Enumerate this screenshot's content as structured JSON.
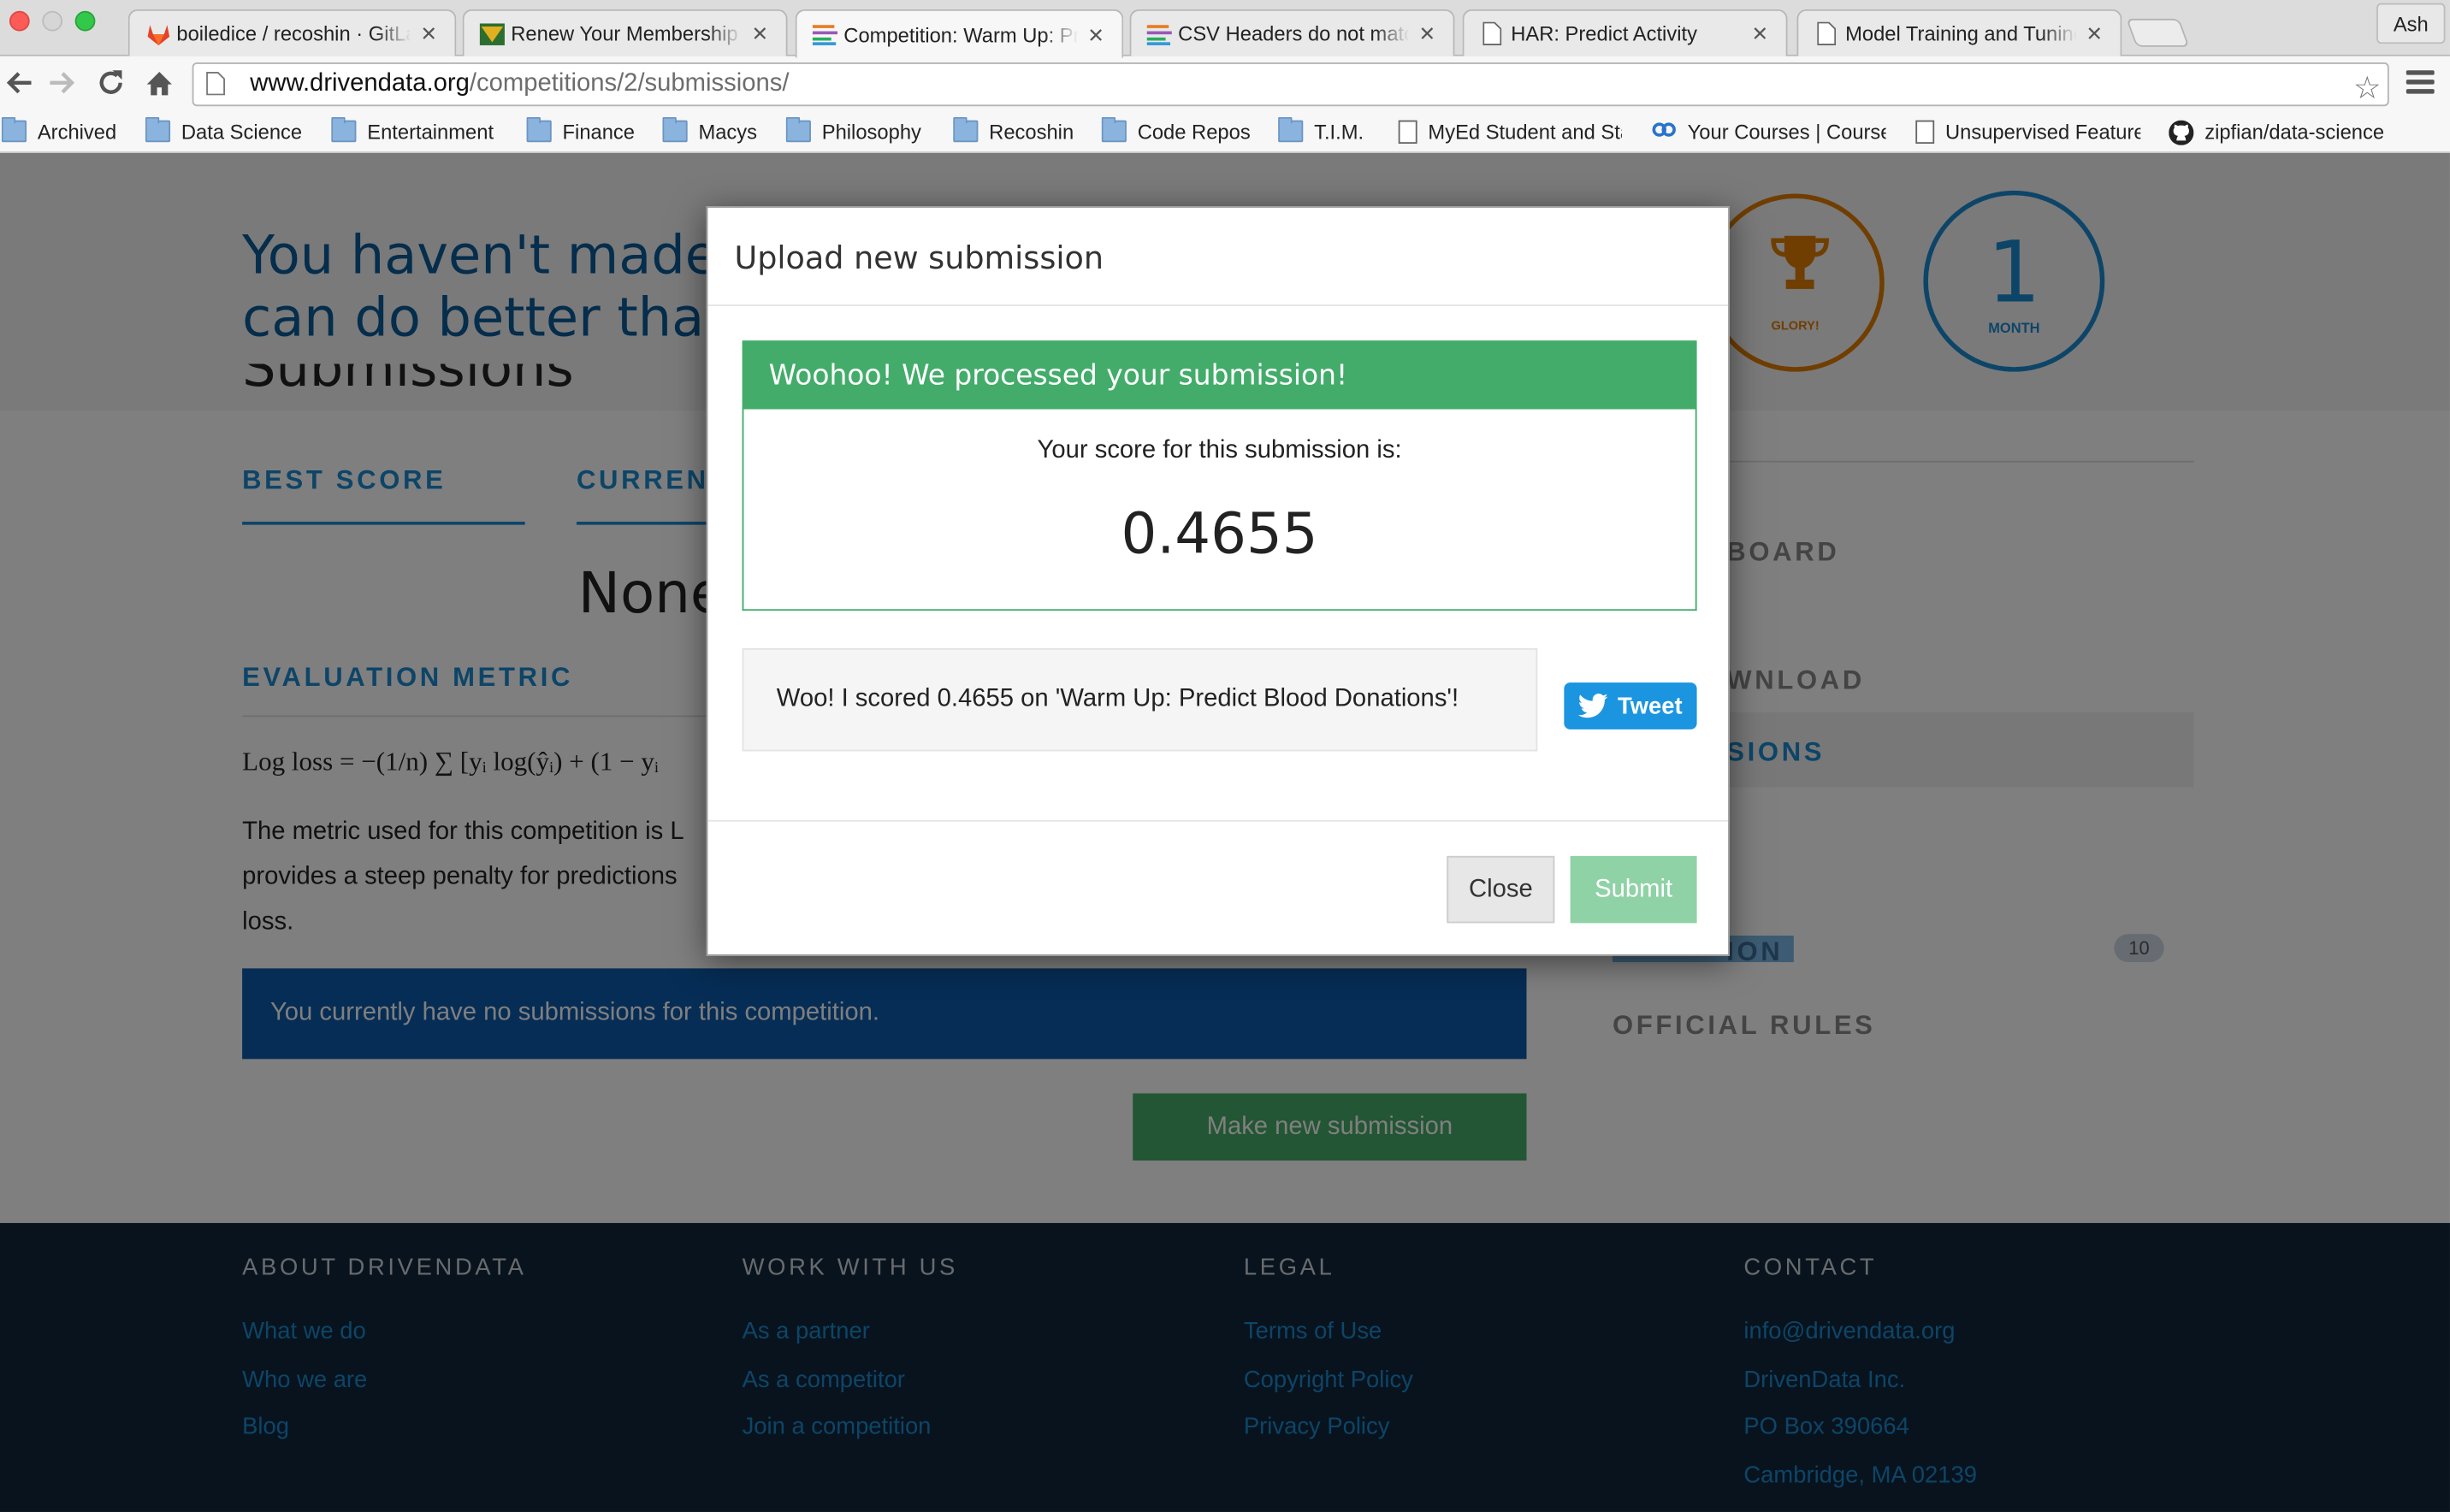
{
  "browser": {
    "profile_name": "Ash",
    "tabs": [
      {
        "title": "boiledice / recoshin · GitLab",
        "icon": "gitlab-icon"
      },
      {
        "title": "Renew Your Membership | Macys",
        "icon": "macys-icon"
      },
      {
        "title": "Competition: Warm Up: Predict Blood Donations",
        "icon": "drivendata-icon",
        "active": true
      },
      {
        "title": "CSV Headers do not match",
        "icon": "drivendata-icon"
      },
      {
        "title": "HAR: Predict Activity",
        "icon": "page-icon"
      },
      {
        "title": "Model Training and Tuning",
        "icon": "page-icon"
      }
    ],
    "url_host": "www.drivendata.org",
    "url_path": "/competitions/2/submissions/",
    "bookmarks": [
      {
        "label": "Archived",
        "icon": "folder-icon"
      },
      {
        "label": "Data Science",
        "icon": "folder-icon"
      },
      {
        "label": "Entertainment",
        "icon": "folder-icon"
      },
      {
        "label": "Finance",
        "icon": "folder-icon"
      },
      {
        "label": "Macys",
        "icon": "folder-icon"
      },
      {
        "label": "Philosophy",
        "icon": "folder-icon"
      },
      {
        "label": "Recoshin",
        "icon": "folder-icon"
      },
      {
        "label": "Code Repos",
        "icon": "folder-icon"
      },
      {
        "label": "T.I.M.",
        "icon": "folder-icon"
      },
      {
        "label": "MyEd Student and Staff",
        "icon": "page-icon"
      },
      {
        "label": "Your Courses | Coursera",
        "icon": "coursera-icon"
      },
      {
        "label": "Unsupervised Feature",
        "icon": "page-icon"
      },
      {
        "label": "zipfian/data-science",
        "icon": "github-icon"
      }
    ]
  },
  "hero": {
    "text_line1": "You haven't made a",
    "text_line2": "can do better than",
    "badge_glory_label": "GLORY!",
    "badge_month_number": "1",
    "badge_month_label": "MONTH"
  },
  "main": {
    "heading": "Submissions",
    "best_score_label": "BEST SCORE",
    "current_label": "CURRENT",
    "best_score_value": "None",
    "eval_label": "EVALUATION METRIC",
    "formula": "Log loss = −(1/n) ∑ [yᵢ log(ŷᵢ) + (1 − yᵢ",
    "metric_text": "The metric used for this competition is L provides a steep penalty for predictions loss.",
    "no_submissions": "You currently have no submissions for this competition.",
    "make_submission": "Make new submission"
  },
  "right_nav": {
    "leaderboard": "BOARD",
    "download": "WNLOAD",
    "submissions": "SIONS",
    "discussion": "ION",
    "discussion_count": "10",
    "rules": "OFFICIAL RULES"
  },
  "footer": {
    "about_head": "ABOUT DRIVENDATA",
    "about_links": [
      "What we do",
      "Who we are",
      "Blog"
    ],
    "work_head": "WORK WITH US",
    "work_links": [
      "As a partner",
      "As a competitor",
      "Join a competition"
    ],
    "legal_head": "LEGAL",
    "legal_links": [
      "Terms of Use",
      "Copyright Policy",
      "Privacy Policy"
    ],
    "contact_head": "CONTACT",
    "contact_lines": [
      "info@drivendata.org",
      "DrivenData Inc.",
      "PO Box 390664",
      "Cambridge, MA 02139"
    ]
  },
  "modal": {
    "title": "Upload new submission",
    "success_message": "Woohoo! We processed your submission!",
    "score_label": "Your score for this submission is:",
    "score_value": "0.4655",
    "tweet_text": "Woo! I scored 0.4655 on 'Warm Up: Predict Blood Donations'!",
    "tweet_button": "Tweet",
    "close_button": "Close",
    "submit_button": "Submit"
  },
  "colors": {
    "brand_blue": "#1b8bd0",
    "success_green": "#43ac6a",
    "footer_bg": "#10263b",
    "twitter_blue": "#1b95e0"
  }
}
